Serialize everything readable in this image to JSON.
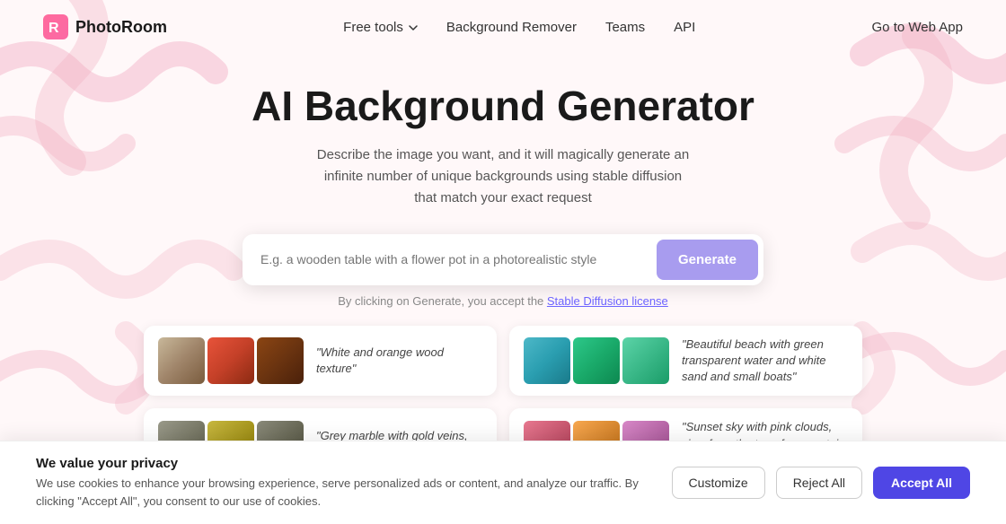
{
  "logo": {
    "name": "PhotoRoom",
    "icon": "R"
  },
  "nav": {
    "items": [
      {
        "label": "Free tools",
        "hasDropdown": true
      },
      {
        "label": "Background Remover"
      },
      {
        "label": "Teams"
      },
      {
        "label": "API"
      }
    ],
    "cta": "Go to Web App"
  },
  "hero": {
    "title": "AI Background Generator",
    "subtitle": "Describe the image you want, and it will magically generate an infinite number of unique backgrounds using stable diffusion that match your exact request",
    "input_placeholder": "E.g. a wooden table with a flower pot in a photorealistic style",
    "generate_label": "Generate",
    "license_text": "By clicking on Generate, you accept the ",
    "license_link": "Stable Diffusion license"
  },
  "cards": [
    {
      "quote": "\"White and orange wood texture\"",
      "images": [
        "wood1",
        "wood2",
        "wood3"
      ]
    },
    {
      "quote": "\"Beautiful beach with green transparent water and white sand and small boats\"",
      "images": [
        "beach1",
        "beach2",
        "beach3"
      ]
    },
    {
      "quote": "\"Grey marble with gold veins, close up view\"",
      "images": [
        "marble1",
        "marble2",
        "marble3"
      ]
    },
    {
      "quote": "\"Sunset sky with pink clouds, view from the top of a mountain, water color style\"",
      "images": [
        "sunset1",
        "sunset2",
        "sunset3"
      ]
    }
  ],
  "cookie": {
    "title": "We value your privacy",
    "description": "We use cookies to enhance your browsing experience, serve personalized ads or content, and analyze our traffic. By clicking \"Accept All\", you consent to our use of cookies.",
    "customize_label": "Customize",
    "reject_label": "Reject All",
    "accept_label": "Accept All"
  }
}
